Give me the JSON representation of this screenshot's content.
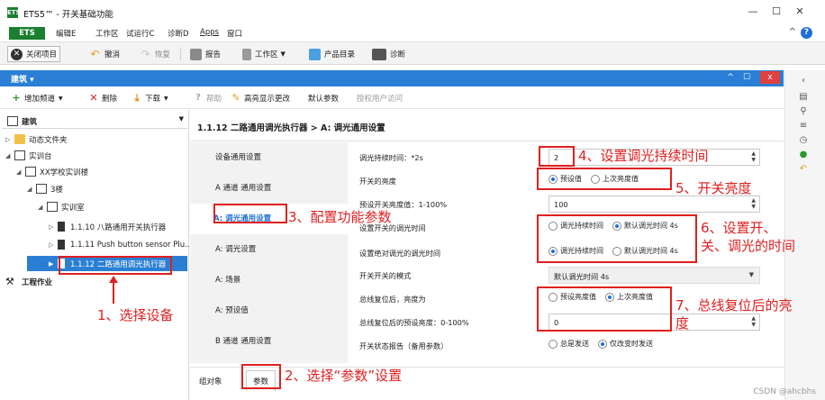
{
  "window": {
    "logo": "ETS",
    "title": "ETS5™ - 开关基础功能",
    "controls": [
      "—",
      "☐",
      "✕"
    ]
  },
  "menubar": {
    "badge": "ETS",
    "items": [
      "编辑E",
      "工作区",
      "试运行C",
      "诊断D",
      "Apps",
      "窗口"
    ],
    "collapse": "^",
    "help": "?"
  },
  "toolbar": {
    "close_project": "关闭项目",
    "undo": "撤消",
    "redo": "恢复",
    "report": "报告",
    "workspace": "工作区",
    "catalog": "产品目录",
    "diagnostics": "诊断"
  },
  "panel": {
    "title": "建筑",
    "controls": [
      "^",
      "☐",
      "x"
    ]
  },
  "actionbar": {
    "add_channel": "增加频道",
    "delete": "删除",
    "download": "下载",
    "help": "帮助",
    "highlight": "高亮显示更改",
    "default_params": "默认参数",
    "authorize": "授权用户访问"
  },
  "tree": {
    "header": "建筑",
    "items": [
      {
        "label": "动态文件夹",
        "exp": "▷"
      },
      {
        "label": "实训台",
        "exp": "◢"
      },
      {
        "label": "XX学校实训楼",
        "exp": "◢"
      },
      {
        "label": "3楼",
        "exp": "◢"
      },
      {
        "label": "实训室",
        "exp": "◢"
      },
      {
        "label": "1.1.10 八路通用开关执行器",
        "exp": "▷"
      },
      {
        "label": "1.1.11 Push button sensor Plu...",
        "exp": "▷"
      },
      {
        "label": "1.1.12 二路通用调光执行器",
        "exp": "▶"
      }
    ],
    "footer": "工程作业"
  },
  "content": {
    "heading": "1.1.12 二路通用调光执行器 > A:  调光通用设置",
    "nav": [
      "设备通用设置",
      "A 通道 通用设置",
      "A:  调光通用设置",
      "A:  调光设置",
      "A:  场景",
      "A:  预设值",
      "B 通道 通用设置"
    ],
    "params": {
      "dim_duration_label": "调光持续时间：*2s",
      "dim_duration_value": "2",
      "switch_brightness_label": "开关的亮度",
      "preset_value_label": "预设值",
      "last_value_label": "上次亮度值",
      "preset_brightness_label": "预设开关亮度值：1-100%",
      "preset_brightness_value": "100",
      "set_switch_dim_label": "设置开关的调光时间",
      "dim_duration_opt": "调光持续时间",
      "default_4s_opt": "默认调光时间 4s",
      "set_abs_dim_label": "设置绝对调光的调光时间",
      "switch_mode_label": "开关开关的模式",
      "switch_mode_value": "默认调光时间 4s",
      "bus_reset_label": "总线复位后，亮度为",
      "preset_brightness_opt": "预设亮度值",
      "last_brightness_opt": "上次亮度值",
      "bus_reset_preset_label": "总线复位后的预设亮度：0-100%",
      "bus_reset_preset_value": "0",
      "status_report_label": "开关状态报告（备用参数）",
      "always_send_opt": "总是发送",
      "on_change_opt": "仅改变时发送"
    },
    "tabs": [
      "组对象",
      "参数"
    ]
  },
  "annotations": {
    "a1": "1、选择设备",
    "a2": "2、选择“参数”设置",
    "a3": "3、配置功能参数",
    "a4": "4、设置调光持续时间",
    "a5": "5、开关亮度",
    "a6": "6、设置开、关、调光的时间",
    "a7": "7、总线复位后的亮度"
  },
  "watermark": "CSDN @ahcbhs",
  "colors": {
    "accent": "#2a7fd4",
    "ets_green": "#1a7f2e",
    "annotation_red": "#e02020"
  },
  "icons": [
    "app-logo-icon",
    "help-icon",
    "close-project-icon",
    "undo-icon",
    "redo-icon",
    "report-icon",
    "workspace-icon",
    "catalog-icon",
    "diagnostics-icon",
    "add-icon",
    "delete-icon",
    "download-icon",
    "help-circle-icon",
    "highlight-icon",
    "folder-icon",
    "building-icon",
    "device-icon",
    "workbench-icon"
  ]
}
